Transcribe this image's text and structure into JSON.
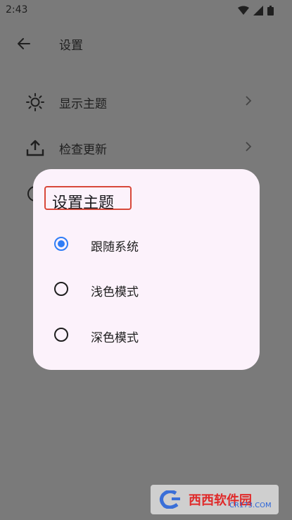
{
  "status_bar": {
    "time": "2:43"
  },
  "app_bar": {
    "title": "设置"
  },
  "settings": {
    "items": [
      {
        "label": "显示主题",
        "icon": "sun-icon"
      },
      {
        "label": "检查更新",
        "icon": "upload-icon"
      },
      {
        "label": "",
        "icon": "info-icon"
      }
    ]
  },
  "dialog": {
    "title": "设置主题",
    "options": [
      {
        "label": "跟随系统",
        "selected": true
      },
      {
        "label": "浅色模式",
        "selected": false
      },
      {
        "label": "深色模式",
        "selected": false
      }
    ]
  },
  "watermark": {
    "brand_text": "西西软件园",
    "url": "CR173.COM"
  },
  "colors": {
    "accent": "#2f7df6",
    "highlight_border": "#d8483a",
    "dialog_bg": "#fcf2fb",
    "scrim": "#7a7a7a"
  }
}
